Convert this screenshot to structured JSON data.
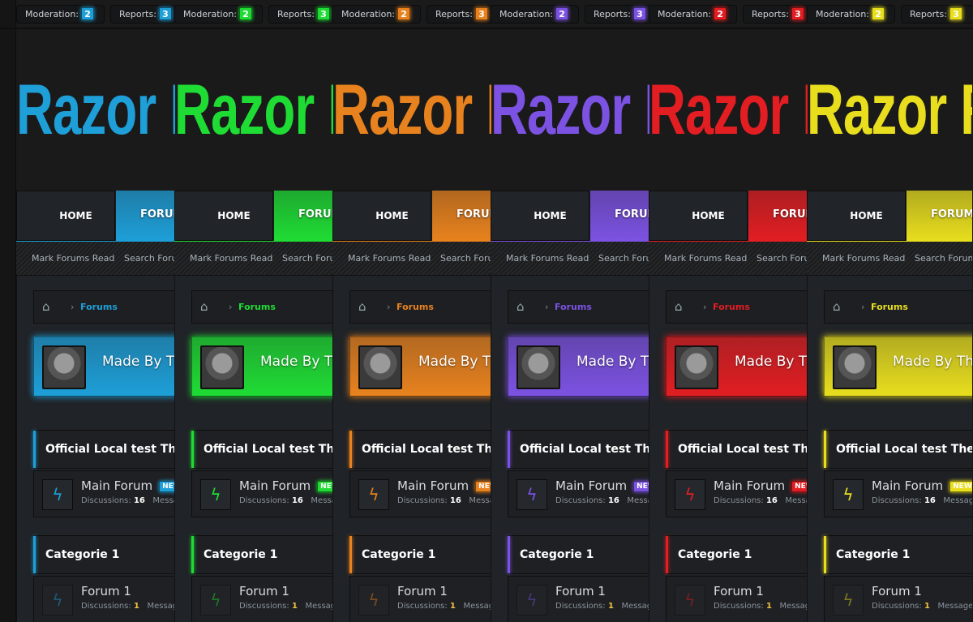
{
  "labels": {
    "moderation": "Moderation:",
    "reports": "Reports:",
    "logo": "Razor",
    "logo_next": "R",
    "home": "HOME",
    "forums": "FORUMS",
    "mark_read": "Mark Forums Read",
    "search_forums": "Search Forums",
    "breadcrumb_forums": "Forums",
    "banner_text": "Made By The",
    "category_1": "Official Local test Themes",
    "forum_1": "Main Forum",
    "new_badge": "NEW",
    "discussions_label": "Discussions:",
    "forum_1_discussions": "16",
    "messages_label": "Messages",
    "category_2": "Categorie 1",
    "forum_2": "Forum 1",
    "forum_2_discussions": "1"
  },
  "columns": [
    {
      "color": "#1e9fd8",
      "moderation_count": "2",
      "reports_count": "3"
    },
    {
      "color": "#1fdc34",
      "moderation_count": "2",
      "reports_count": "3"
    },
    {
      "color": "#e8821e",
      "moderation_count": "2",
      "reports_count": "3"
    },
    {
      "color": "#7c52e2",
      "moderation_count": "2",
      "reports_count": "3"
    },
    {
      "color": "#e21e22",
      "moderation_count": "2",
      "reports_count": "3"
    },
    {
      "color": "#e8de1e",
      "moderation_count": "2",
      "reports_count": "3"
    }
  ],
  "icons": {
    "home": "home-icon",
    "forum": "lightning-bolt-icon"
  }
}
